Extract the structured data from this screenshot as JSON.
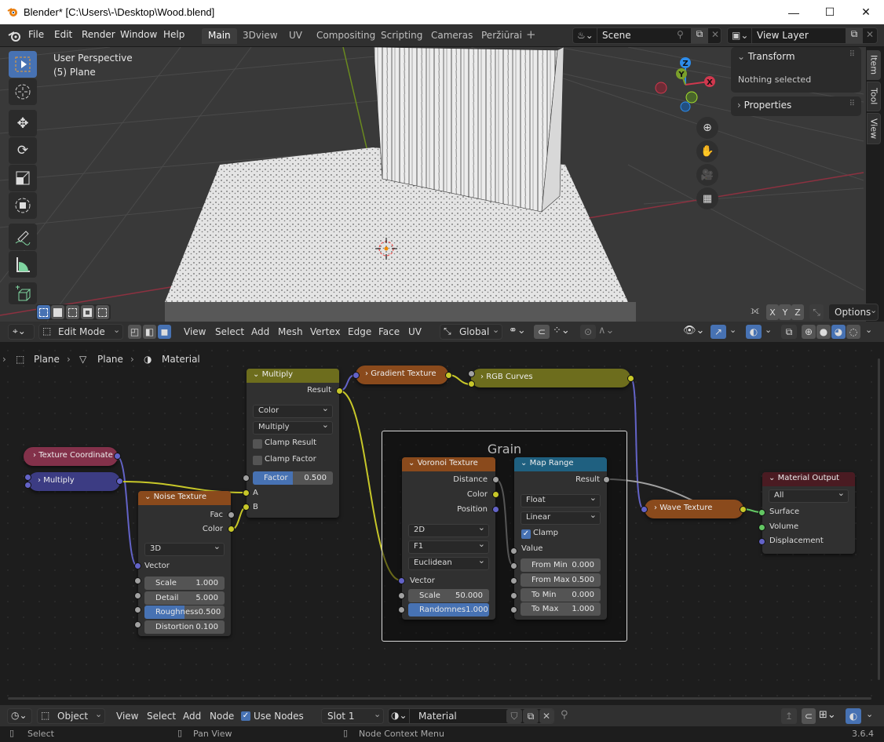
{
  "window": {
    "title": "Blender* [C:\\Users\\-\\Desktop\\Wood.blend]",
    "controls": {
      "minimize": "—",
      "maximize": "☐",
      "close": "✕"
    }
  },
  "menu": {
    "items": [
      "File",
      "Edit",
      "Render",
      "Window",
      "Help"
    ],
    "workspaces": [
      "Main",
      "3Dview",
      "UV",
      "Compositing",
      "Scripting",
      "Cameras",
      "Peržiūrai"
    ],
    "active_workspace": "Main",
    "add_workspace": "+",
    "scene": {
      "value": "Scene"
    },
    "view_layer": {
      "value": "View Layer"
    }
  },
  "viewport": {
    "overlay_title": "User Perspective",
    "overlay_object": "(5) Plane",
    "gizmo_axes": {
      "x": "X",
      "y": "Y",
      "z": "Z"
    },
    "axis_colors": {
      "x": "#d0384e",
      "y": "#7ba02b",
      "z": "#2d8ceb"
    },
    "tools": [
      "select-box",
      "cursor",
      "move",
      "rotate",
      "scale",
      "transform",
      "annotate",
      "measure",
      "add-cube"
    ],
    "nav_buttons": [
      "zoom",
      "pan",
      "camera",
      "ortho-grid"
    ],
    "n_panel": {
      "transform_title": "Transform",
      "transform_text": "Nothing selected",
      "properties_title": "Properties"
    },
    "side_tabs": [
      "Item",
      "Tool",
      "View"
    ],
    "mirror_axes": [
      "X",
      "Y",
      "Z"
    ],
    "options_label": "Options"
  },
  "viewport_header": {
    "mode": "Edit Mode",
    "menus": [
      "View",
      "Select",
      "Add",
      "Mesh",
      "Vertex",
      "Edge",
      "Face",
      "UV"
    ],
    "orientation": "Global"
  },
  "node_editor": {
    "breadcrumb": [
      "Plane",
      "Plane",
      "Material"
    ],
    "frame_label": "Grain",
    "nodes": {
      "texture_coordinate": {
        "title": "Texture Coordinate"
      },
      "multiply_vec": {
        "title": "Multiply"
      },
      "noise": {
        "title": "Noise Texture",
        "outputs": [
          "Fac",
          "Color"
        ],
        "dimension": "3D",
        "input_vector": "Vector",
        "fields": [
          {
            "label": "Scale",
            "value": "1.000"
          },
          {
            "label": "Detail",
            "value": "5.000"
          },
          {
            "label": "Roughness",
            "value": "0.500",
            "fill": 0.5
          },
          {
            "label": "Distortion",
            "value": "0.100"
          }
        ]
      },
      "mix": {
        "title": "Multiply",
        "output": "Result",
        "data_type": "Color",
        "blend": "Multiply",
        "clamp_result": "Clamp Result",
        "clamp_factor": "Clamp Factor",
        "factor_label": "Factor",
        "factor_value": "0.500",
        "factor_fill": 0.5,
        "input_a": "A",
        "input_b": "B"
      },
      "gradient": {
        "title": "Gradient Texture"
      },
      "rgb_curves": {
        "title": "RGB Curves"
      },
      "voronoi": {
        "title": "Voronoi Texture",
        "outputs": [
          "Distance",
          "Color",
          "Position"
        ],
        "dimension": "2D",
        "feature": "F1",
        "metric": "Euclidean",
        "input_vector": "Vector",
        "scale_label": "Scale",
        "scale_value": "50.000",
        "random_label": "Randomnes",
        "random_value": "1.000",
        "random_fill": 1.0
      },
      "map_range": {
        "title": "Map Range",
        "output": "Result",
        "data_type": "Float",
        "interpolation": "Linear",
        "clamp": "Clamp",
        "clamp_checked": true,
        "input_value": "Value",
        "fields": [
          {
            "label": "From Min",
            "value": "0.000"
          },
          {
            "label": "From Max",
            "value": "0.500"
          },
          {
            "label": "To Min",
            "value": "0.000"
          },
          {
            "label": "To Max",
            "value": "1.000"
          }
        ]
      },
      "wave": {
        "title": "Wave Texture"
      },
      "output": {
        "title": "Material Output",
        "target": "All",
        "inputs": [
          "Surface",
          "Volume",
          "Displacement"
        ]
      }
    },
    "colors": {
      "texture_header": "#8a4a1c",
      "converter_header": "#1f6080",
      "color_header": "#6d6d1d",
      "vector_header": "#3c3c83",
      "input_header": "#83314a",
      "output_header": "#4a1b22"
    }
  },
  "node_header": {
    "object_mode": "Object",
    "menus": [
      "View",
      "Select",
      "Add",
      "Node"
    ],
    "use_nodes_label": "Use Nodes",
    "use_nodes_checked": true,
    "slot": "Slot 1",
    "material": "Material"
  },
  "status_bar": {
    "hints": [
      "Select",
      "Pan View",
      "Node Context Menu"
    ],
    "version": "3.6.4"
  }
}
